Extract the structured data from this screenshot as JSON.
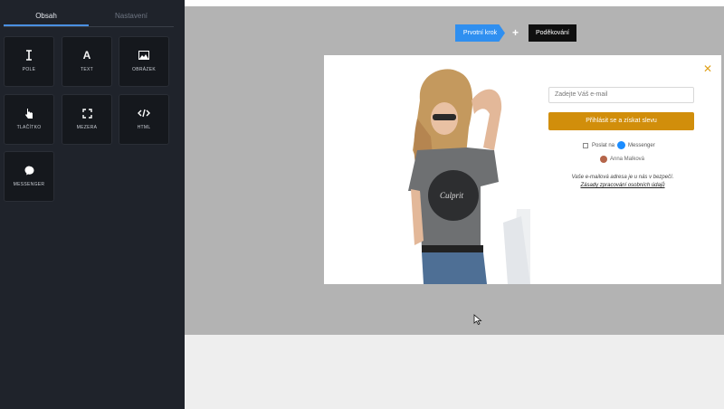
{
  "sidebar": {
    "tabs": [
      {
        "label": "Obsah"
      },
      {
        "label": "Nastavení"
      }
    ],
    "tiles": [
      {
        "label": "POLE",
        "icon": "text-cursor-icon"
      },
      {
        "label": "TEXT",
        "icon": "letter-a-icon"
      },
      {
        "label": "OBRÁZEK",
        "icon": "image-icon"
      },
      {
        "label": "TLAČÍTKO",
        "icon": "hand-pointer-icon"
      },
      {
        "label": "MEZERA",
        "icon": "expand-icon"
      },
      {
        "label": "HTML",
        "icon": "code-icon"
      },
      {
        "label": "MESSENGER",
        "icon": "messenger-icon"
      }
    ]
  },
  "steps": {
    "first": "Prvotní krok",
    "plus": "+",
    "second": "Poděkování"
  },
  "popup": {
    "close": "✕",
    "email_placeholder": "Zadejte Váš e-mail",
    "submit": "Přihlásit se a získat slevu",
    "messenger_prefix": "Poslat na",
    "messenger_label": "Messenger",
    "user": "Anna Malková",
    "legal_text": "Vaše e-mailová adresa je u nás v bezpečí.",
    "legal_link": "Zásady zpracování osobních údajů"
  },
  "colors": {
    "accent_blue": "#2f8ff0",
    "submit_orange": "#d18e0b",
    "sidebar_bg": "#1f232b"
  }
}
